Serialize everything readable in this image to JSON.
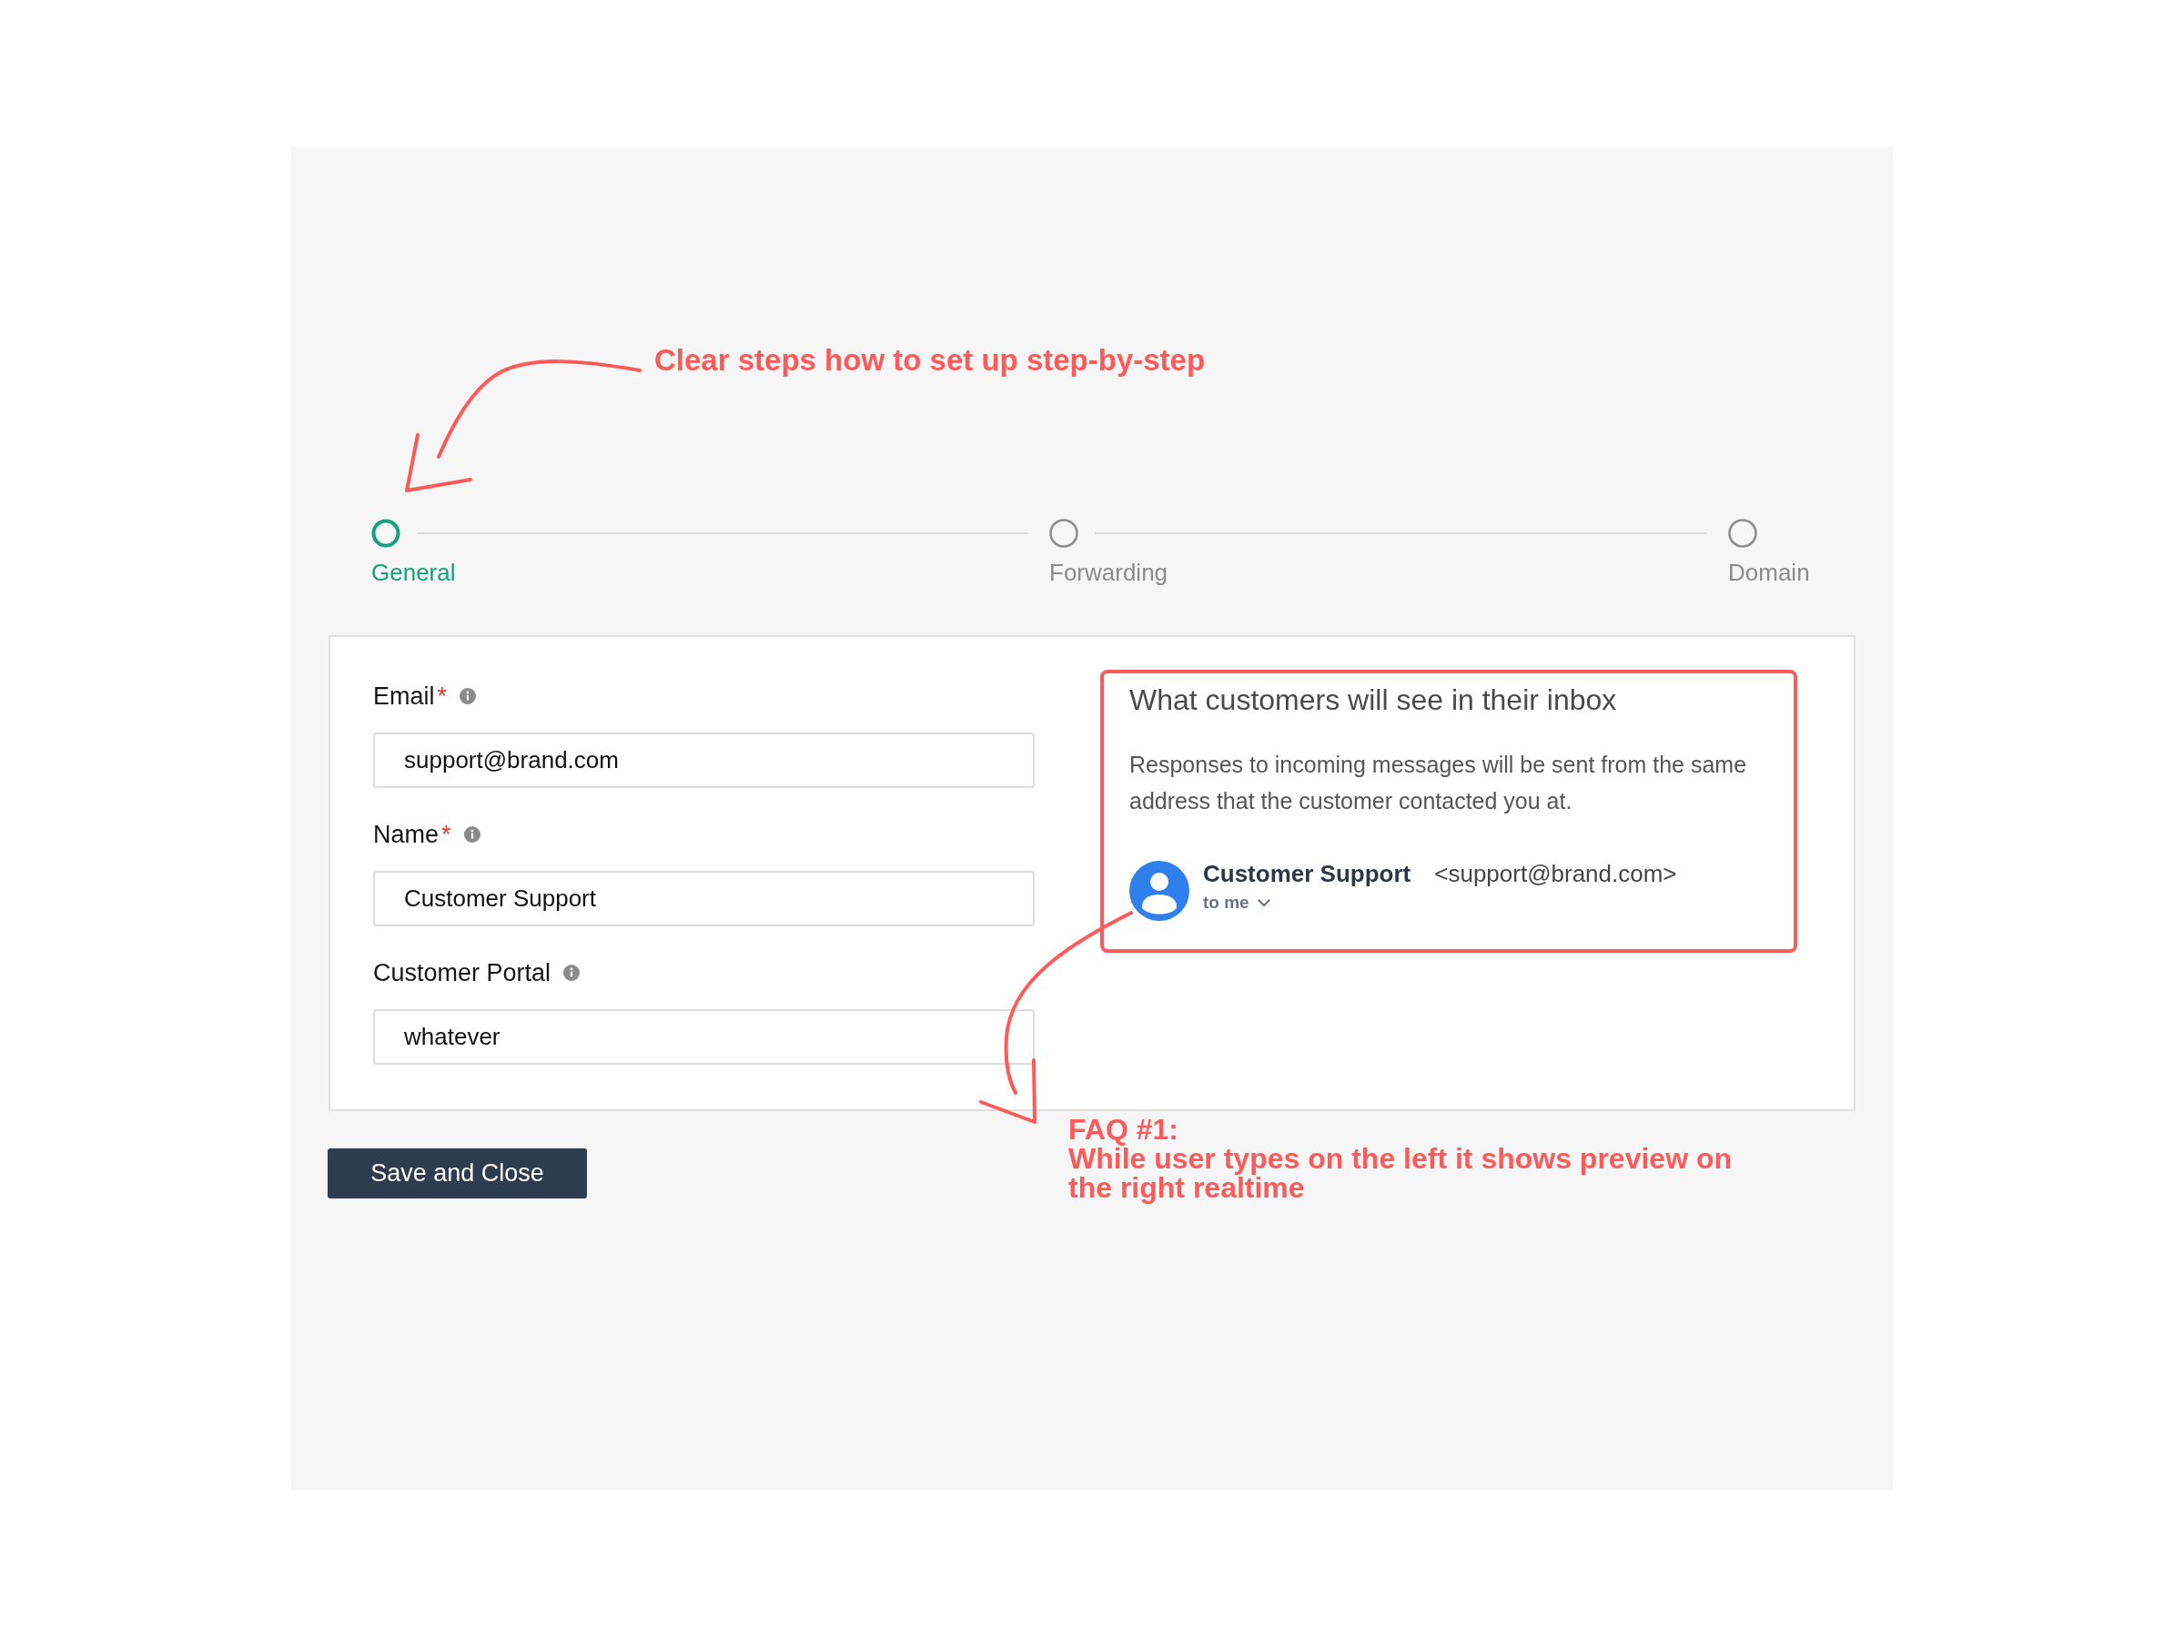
{
  "steps_note": "Clear steps how to set up step-by-step",
  "steps": [
    {
      "label": "General",
      "selected": true
    },
    {
      "label": "Forwarding",
      "selected": false
    },
    {
      "label": "Domain",
      "selected": false
    }
  ],
  "form": {
    "fields": [
      {
        "label": "Email",
        "required_mark": "*",
        "value": "support@brand.com"
      },
      {
        "label": "Name",
        "required_mark": "*",
        "value": "Customer Support"
      },
      {
        "label": "Customer Portal",
        "value": "whatever"
      }
    ]
  },
  "preview": {
    "title": "What customers will see in their inbox",
    "description": "Responses to incoming messages will be sent from the same address that the customer contacted you at.",
    "sender_name": "Customer Support",
    "sender_address": "<support@brand.com>",
    "recipient": "to me"
  },
  "faq": {
    "title": "FAQ #1:",
    "text": "While user types on the left it shows preview on the right realtime"
  },
  "save_button": {
    "label": "Save and Close"
  }
}
